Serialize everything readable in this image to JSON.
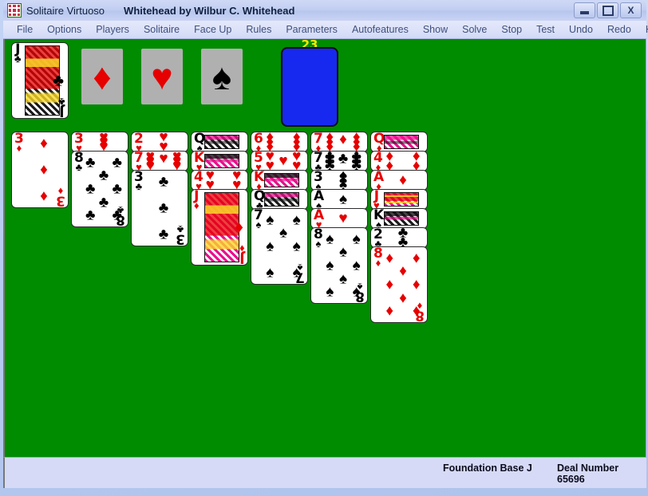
{
  "window": {
    "title": "Solitaire Virtuoso",
    "subtitle": "Whitehead by Wilbur C. Whitehead",
    "app_icon": "cards-icon",
    "buttons": {
      "minimize": "minimize",
      "maximize": "maximize",
      "close": "X"
    }
  },
  "menubar": {
    "items": [
      "File",
      "Options",
      "Players",
      "Solitaire",
      "Face Up",
      "Rules",
      "Parameters",
      "Autofeatures",
      "Show",
      "Solve",
      "Stop",
      "Test",
      "Undo",
      "Redo",
      "Help"
    ]
  },
  "colors": {
    "table_green": "#008c00",
    "card_back_blue": "#1729ef",
    "placeholder_gray": "#b0b0b0",
    "score_yellow": "#ffe800",
    "red_suit": "#e60000",
    "black_suit": "#000000",
    "chrome_lavender": "#d6daf6"
  },
  "stock": {
    "count": "23",
    "face_down": true,
    "label": "stock-pile"
  },
  "foundations": [
    {
      "rank": "J",
      "suit": "clubs",
      "symbol": "♣",
      "color": "black",
      "face": true,
      "empty": false
    },
    {
      "rank": "",
      "suit": "diamonds",
      "symbol": "♦",
      "color": "red",
      "face": false,
      "empty": true
    },
    {
      "rank": "",
      "suit": "hearts",
      "symbol": "♥",
      "color": "red",
      "face": false,
      "empty": true
    },
    {
      "rank": "",
      "suit": "spades",
      "symbol": "♠",
      "color": "black",
      "face": false,
      "empty": true
    }
  ],
  "tableau": [
    {
      "column": 1,
      "cards": [
        {
          "rank": "3",
          "suit": "diamonds",
          "symbol": "♦",
          "color": "red"
        }
      ]
    },
    {
      "column": 2,
      "cards": [
        {
          "rank": "3",
          "suit": "hearts",
          "symbol": "♥",
          "color": "red"
        },
        {
          "rank": "8",
          "suit": "clubs",
          "symbol": "♣",
          "color": "black"
        }
      ]
    },
    {
      "column": 3,
      "cards": [
        {
          "rank": "2",
          "suit": "hearts",
          "symbol": "♥",
          "color": "red"
        },
        {
          "rank": "7",
          "suit": "hearts",
          "symbol": "♥",
          "color": "red"
        },
        {
          "rank": "3",
          "suit": "clubs",
          "symbol": "♣",
          "color": "black"
        }
      ]
    },
    {
      "column": 4,
      "cards": [
        {
          "rank": "Q",
          "suit": "spades",
          "symbol": "♠",
          "color": "black"
        },
        {
          "rank": "K",
          "suit": "hearts",
          "symbol": "♥",
          "color": "red"
        },
        {
          "rank": "4",
          "suit": "hearts",
          "symbol": "♥",
          "color": "red"
        },
        {
          "rank": "J",
          "suit": "diamonds",
          "symbol": "♦",
          "color": "red"
        }
      ]
    },
    {
      "column": 5,
      "cards": [
        {
          "rank": "6",
          "suit": "diamonds",
          "symbol": "♦",
          "color": "red"
        },
        {
          "rank": "5",
          "suit": "hearts",
          "symbol": "♥",
          "color": "red"
        },
        {
          "rank": "K",
          "suit": "diamonds",
          "symbol": "♦",
          "color": "red"
        },
        {
          "rank": "Q",
          "suit": "clubs",
          "symbol": "♣",
          "color": "black"
        },
        {
          "rank": "7",
          "suit": "spades",
          "symbol": "♠",
          "color": "black"
        }
      ]
    },
    {
      "column": 6,
      "cards": [
        {
          "rank": "7",
          "suit": "diamonds",
          "symbol": "♦",
          "color": "red"
        },
        {
          "rank": "7",
          "suit": "clubs",
          "symbol": "♣",
          "color": "black"
        },
        {
          "rank": "3",
          "suit": "spades",
          "symbol": "♠",
          "color": "black"
        },
        {
          "rank": "A",
          "suit": "spades",
          "symbol": "♠",
          "color": "black"
        },
        {
          "rank": "A",
          "suit": "hearts",
          "symbol": "♥",
          "color": "red"
        },
        {
          "rank": "8",
          "suit": "spades",
          "symbol": "♠",
          "color": "black"
        }
      ]
    },
    {
      "column": 7,
      "cards": [
        {
          "rank": "Q",
          "suit": "diamonds",
          "symbol": "♦",
          "color": "red"
        },
        {
          "rank": "4",
          "suit": "diamonds",
          "symbol": "♦",
          "color": "red"
        },
        {
          "rank": "A",
          "suit": "diamonds",
          "symbol": "♦",
          "color": "red"
        },
        {
          "rank": "J",
          "suit": "hearts",
          "symbol": "♥",
          "color": "red"
        },
        {
          "rank": "K",
          "suit": "spades",
          "symbol": "♠",
          "color": "black"
        },
        {
          "rank": "2",
          "suit": "clubs",
          "symbol": "♣",
          "color": "black"
        },
        {
          "rank": "8",
          "suit": "diamonds",
          "symbol": "♦",
          "color": "red"
        }
      ]
    }
  ],
  "statusbar": {
    "foundation_base": "Foundation Base J",
    "deal_label": "Deal Number",
    "deal_value": "65696"
  }
}
